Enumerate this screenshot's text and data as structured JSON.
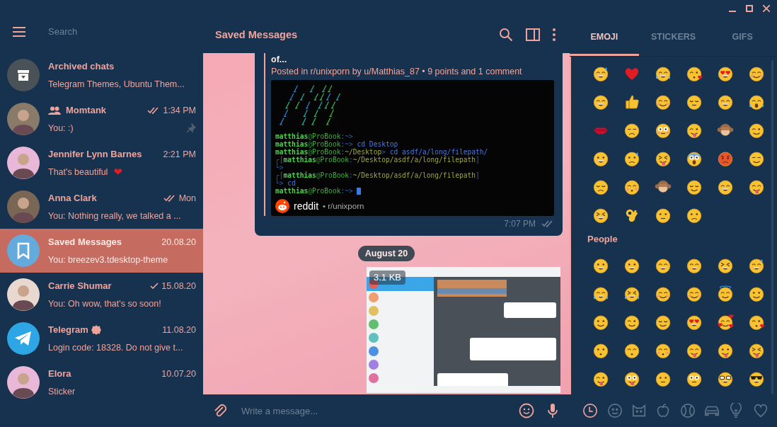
{
  "sidebar": {
    "search": {
      "placeholder": "Search"
    },
    "chats": [
      {
        "kind": "archive",
        "name": "Archived chats",
        "preview": "Telegram Themes, Ubuntu Them...",
        "sent": false,
        "pinned": false,
        "verified": false,
        "selected": false
      },
      {
        "kind": "group",
        "name": "Momtank",
        "time": "1:34 PM",
        "sent": true,
        "read": true,
        "preview": "You: :)",
        "pinned": true,
        "verified": false,
        "selected": false
      },
      {
        "kind": "person",
        "name": "Jennifer Lynn Barnes",
        "time": "2:21 PM",
        "preview": "That's beautiful",
        "emoji": "❤",
        "sent": false,
        "pinned": false,
        "verified": false,
        "selected": false
      },
      {
        "kind": "person",
        "name": "Anna Clark",
        "time": "Mon",
        "sent": true,
        "read": true,
        "preview": "You: Nothing really, we talked a ...",
        "pinned": false,
        "verified": false,
        "selected": false
      },
      {
        "kind": "saved",
        "name": "Saved Messages",
        "time": "20.08.20",
        "preview": "You: breezev3.tdesktop-theme",
        "sent": false,
        "pinned": false,
        "verified": false,
        "selected": true
      },
      {
        "kind": "person",
        "name": "Carrie Shumar",
        "time": "15.08.20",
        "sent": true,
        "read": false,
        "preview": "You: Oh wow, that's so soon!",
        "pinned": false,
        "verified": false,
        "selected": false
      },
      {
        "kind": "official",
        "name": "Telegram",
        "verified": true,
        "time": "11.08.20",
        "preview": "Login code: 18328. Do not give t...",
        "sent": false,
        "pinned": false,
        "selected": false
      },
      {
        "kind": "person",
        "name": "Elora",
        "time": "10.07.20",
        "preview": "Sticker",
        "sent": false,
        "pinned": false,
        "verified": false,
        "selected": false
      }
    ]
  },
  "chat": {
    "title": "Saved Messages",
    "messages": [
      {
        "kind": "link_preview",
        "title": "of...",
        "meta": "Posted in r/unixporn by u/Matthias_87 • 9 points and 1 comment",
        "terminal": {
          "cursor": true,
          "lines": [
            [
              {
                "kind": "user",
                "text": "matthias"
              },
              {
                "kind": "at",
                "text": "@"
              },
              {
                "kind": "host",
                "text": "ProBook"
              },
              {
                "kind": "sep",
                "text": ":~>"
              }
            ],
            [
              {
                "kind": "user",
                "text": "matthias"
              },
              {
                "kind": "at",
                "text": "@"
              },
              {
                "kind": "host",
                "text": "ProBook"
              },
              {
                "kind": "sep",
                "text": ":~>"
              },
              {
                "kind": "cmd",
                "text": " cd Desktop"
              }
            ],
            [
              {
                "kind": "user",
                "text": "matthias"
              },
              {
                "kind": "at",
                "text": "@"
              },
              {
                "kind": "host",
                "text": "ProBook"
              },
              {
                "kind": "sep",
                "text": ":"
              },
              {
                "kind": "path",
                "text": "~/Desktop"
              },
              {
                "kind": "sep",
                "text": ">"
              },
              {
                "kind": "cmd",
                "text": " cd asdf/a/long/filepath/"
              }
            ],
            [
              {
                "kind": "bracket",
                "text": "┌["
              },
              {
                "kind": "user",
                "text": "matthias"
              },
              {
                "kind": "at",
                "text": "@"
              },
              {
                "kind": "host",
                "text": "ProBook"
              },
              {
                "kind": "sep",
                "text": ":"
              },
              {
                "kind": "path",
                "text": "~/Desktop/asdf/a/long/filepath"
              },
              {
                "kind": "bracket",
                "text": "]"
              }
            ],
            [
              {
                "kind": "bracket",
                "text": "└>"
              }
            ],
            [
              {
                "kind": "bracket",
                "text": "┌["
              },
              {
                "kind": "user",
                "text": "matthias"
              },
              {
                "kind": "at",
                "text": "@"
              },
              {
                "kind": "host",
                "text": "ProBook"
              },
              {
                "kind": "sep",
                "text": ":"
              },
              {
                "kind": "path",
                "text": "~/Desktop/asdf/a/long/filepath"
              },
              {
                "kind": "bracket",
                "text": "]"
              }
            ],
            [
              {
                "kind": "bracket",
                "text": "└>"
              },
              {
                "kind": "cmd",
                "text": " cd"
              }
            ],
            [
              {
                "kind": "user",
                "text": "matthias"
              },
              {
                "kind": "at",
                "text": "@"
              },
              {
                "kind": "host",
                "text": "ProBook"
              },
              {
                "kind": "sep",
                "text": ":~>"
              }
            ]
          ]
        },
        "site": "reddit",
        "source": "• r/unixporn",
        "time": "7:07 PM",
        "sent": true,
        "read": true
      },
      {
        "kind": "date",
        "text": "August 20"
      },
      {
        "size": "3.1 KB"
      }
    ],
    "composer": {
      "placeholder": "Write a message..."
    }
  },
  "emoji_panel": {
    "tabs": [
      {
        "label": "EMOJI",
        "selected": true
      },
      {
        "label": "STICKERS",
        "selected": false
      },
      {
        "label": "GIFS",
        "selected": false
      }
    ],
    "section_title": "People",
    "categories": [
      {
        "selected": true
      },
      {
        "selected": false
      },
      {
        "selected": false
      },
      {
        "selected": false
      },
      {
        "selected": false
      },
      {
        "selected": false
      },
      {
        "selected": false
      },
      {
        "selected": false
      }
    ]
  }
}
